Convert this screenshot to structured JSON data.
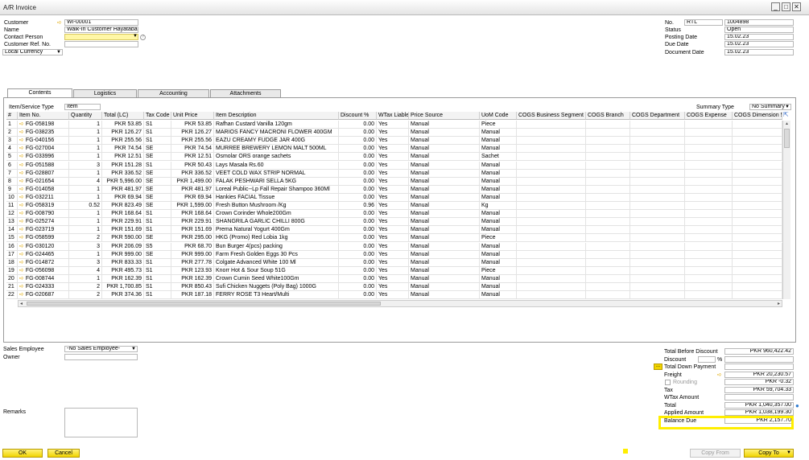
{
  "window": {
    "title": "A/R Invoice"
  },
  "header_left": {
    "customer_label": "Customer",
    "customer_value": "WI-00001",
    "name_label": "Name",
    "name_value": "Walk-In Customer Hayatabad",
    "contact_label": "Contact Person",
    "contact_value": "",
    "ref_label": "Customer Ref. No.",
    "ref_value": "",
    "currency_value": "Local Currency"
  },
  "header_right": {
    "no_label": "No.",
    "series_value": "RTL",
    "number_value": "1004898",
    "status_label": "Status",
    "status_value": "Open",
    "posting_label": "Posting Date",
    "posting_value": "15.02.23",
    "due_label": "Due Date",
    "due_value": "15.02.23",
    "doc_label": "Document Date",
    "doc_value": "15.02.23"
  },
  "tabs": [
    "Contents",
    "Logistics",
    "Accounting",
    "Attachments"
  ],
  "contents": {
    "item_type_label": "Item/Service Type",
    "item_type_value": "Item",
    "summary_label": "Summary Type",
    "summary_value": "No Summary"
  },
  "grid": {
    "columns": [
      "#",
      "Item No.",
      "Quantity",
      "Total (LC)",
      "Tax Code",
      "Unit Price",
      "Item Description",
      "Discount %",
      "WTax Liable",
      "Price Source",
      "UoM Code",
      "COGS Business Segment",
      "COGS Branch",
      "COGS Department",
      "COGS Expense",
      "COGS Dimension 5"
    ],
    "rows": [
      [
        "1",
        "FG-058198",
        "1",
        "PKR 53.85",
        "S1",
        "PKR 53.85",
        "Rafhan Custard Vanilla 120gm",
        "0.00",
        "Yes",
        "Manual",
        "Piece"
      ],
      [
        "2",
        "FG-038235",
        "1",
        "PKR 126.27",
        "S1",
        "PKR 126.27",
        "MARIOS FANCY MACRONI FLOWER 400GM",
        "0.00",
        "Yes",
        "Manual",
        "Manual"
      ],
      [
        "3",
        "FG-040156",
        "1",
        "PKR 255.56",
        "S1",
        "PKR 255.56",
        "EAZU CREAMY FUDGE JAR 400G",
        "0.00",
        "Yes",
        "Manual",
        "Manual"
      ],
      [
        "4",
        "FG-027004",
        "1",
        "PKR 74.54",
        "SE",
        "PKR 74.54",
        "MURREE BREWERY LEMON MALT 500ML",
        "0.00",
        "Yes",
        "Manual",
        "Manual"
      ],
      [
        "5",
        "FG-033996",
        "1",
        "PKR 12.51",
        "SE",
        "PKR 12.51",
        "Osmolar ORS orange sachets",
        "0.00",
        "Yes",
        "Manual",
        "Sachet"
      ],
      [
        "6",
        "FG-051588",
        "3",
        "PKR 151.28",
        "S1",
        "PKR 50.43",
        "Lays Masala Rs.60",
        "0.00",
        "Yes",
        "Manual",
        "Manual"
      ],
      [
        "7",
        "FG-028807",
        "1",
        "PKR 336.52",
        "SE",
        "PKR 336.52",
        "VEET COLD WAX STRIP NORMAL",
        "0.00",
        "Yes",
        "Manual",
        "Manual"
      ],
      [
        "8",
        "FG-021654",
        "4",
        "PKR 5,996.00",
        "SE",
        "PKR 1,499.00",
        "FALAK PESHWARI SELLA 5KG",
        "0.00",
        "Yes",
        "Manual",
        "Manual"
      ],
      [
        "9",
        "FG-014058",
        "1",
        "PKR 481.97",
        "SE",
        "PKR 481.97",
        "Loreal Public--Lp Fall Repair Shampoo 360Ml",
        "0.00",
        "Yes",
        "Manual",
        "Manual"
      ],
      [
        "10",
        "FG-032211",
        "1",
        "PKR 69.94",
        "SE",
        "PKR 69.94",
        "Hankies FACIAL Tissue",
        "0.00",
        "Yes",
        "Manual",
        "Manual"
      ],
      [
        "11",
        "FG-058319",
        "0.52",
        "PKR 823.49",
        "SE",
        "PKR 1,599.00",
        "Fresh Button Mushroom /Kg",
        "0.96",
        "Yes",
        "Manual",
        "Kg"
      ],
      [
        "12",
        "FG-008790",
        "1",
        "PKR 168.64",
        "S1",
        "PKR 168.64",
        "Crown Corinder Whole200Gm",
        "0.00",
        "Yes",
        "Manual",
        "Manual"
      ],
      [
        "13",
        "FG-025274",
        "1",
        "PKR 229.91",
        "S1",
        "PKR 229.91",
        "SHANGRILA GARLIC CHILLI 800G",
        "0.00",
        "Yes",
        "Manual",
        "Manual"
      ],
      [
        "14",
        "FG-023719",
        "1",
        "PKR 151.69",
        "S1",
        "PKR 151.69",
        "Prema Natural Yogurt 400Gm",
        "0.00",
        "Yes",
        "Manual",
        "Manual"
      ],
      [
        "15",
        "FG-058599",
        "2",
        "PKR 590.00",
        "SE",
        "PKR 295.00",
        "HKG (Promo) Red Lobia 1kg",
        "0.00",
        "Yes",
        "Manual",
        "Piece"
      ],
      [
        "16",
        "FG-030120",
        "3",
        "PKR 206.09",
        "S5",
        "PKR 68.70",
        "Bun Burger 4(pcs) packing",
        "0.00",
        "Yes",
        "Manual",
        "Manual"
      ],
      [
        "17",
        "FG-024465",
        "1",
        "PKR 999.00",
        "SE",
        "PKR 999.00",
        "Farm Fresh Golden Eggs 30 Pcs",
        "0.00",
        "Yes",
        "Manual",
        "Manual"
      ],
      [
        "18",
        "FG-014872",
        "3",
        "PKR 833.33",
        "S1",
        "PKR 277.78",
        "Colgate Advanced White 100 Ml",
        "0.00",
        "Yes",
        "Manual",
        "Manual"
      ],
      [
        "19",
        "FG-056098",
        "4",
        "PKR 495.73",
        "S1",
        "PKR 123.93",
        "Knorr Hot & Sour Soup 51G",
        "0.00",
        "Yes",
        "Manual",
        "Piece"
      ],
      [
        "20",
        "FG-008744",
        "1",
        "PKR 162.39",
        "S1",
        "PKR 162.39",
        "Crown Cumin Seed White100Gm",
        "0.00",
        "Yes",
        "Manual",
        "Manual"
      ],
      [
        "21",
        "FG-024333",
        "2",
        "PKR 1,700.85",
        "S1",
        "PKR 850.43",
        "Sufi Chicken Nuggets (Poly Bag) 1000G",
        "0.00",
        "Yes",
        "Manual",
        "Manual"
      ],
      [
        "22",
        "FG-020687",
        "2",
        "PKR 374.36",
        "S1",
        "PKR 187.18",
        "FERRY ROSE T3 Heart/Multi",
        "0.00",
        "Yes",
        "Manual",
        "Manual"
      ]
    ]
  },
  "footer_left": {
    "sales_label": "Sales Employee",
    "sales_value": "-No Sales Employee-",
    "owner_label": "Owner",
    "remarks_label": "Remarks"
  },
  "totals": {
    "before_discount_label": "Total Before Discount",
    "before_discount_value": "PKR 960,422.42",
    "discount_label": "Discount",
    "pct_label": "%",
    "down_payment_label": "Total Down Payment",
    "freight_label": "Freight",
    "freight_value": "PKR 20,230.57",
    "rounding_label": "Rounding",
    "rounding_value": "PKR -0.32",
    "tax_label": "Tax",
    "tax_value": "PKR 59,704.33",
    "wtax_label": "WTax Amount",
    "total_label": "Total",
    "total_value": "PKR 1,040,357.00",
    "applied_label": "Applied Amount",
    "applied_value": "PKR 1,038,199.30",
    "balance_label": "Balance Due",
    "balance_value": "PKR 2,157.70"
  },
  "buttons": {
    "ok": "OK",
    "cancel": "Cancel",
    "copy_from": "Copy From",
    "copy_to": "Copy To"
  }
}
